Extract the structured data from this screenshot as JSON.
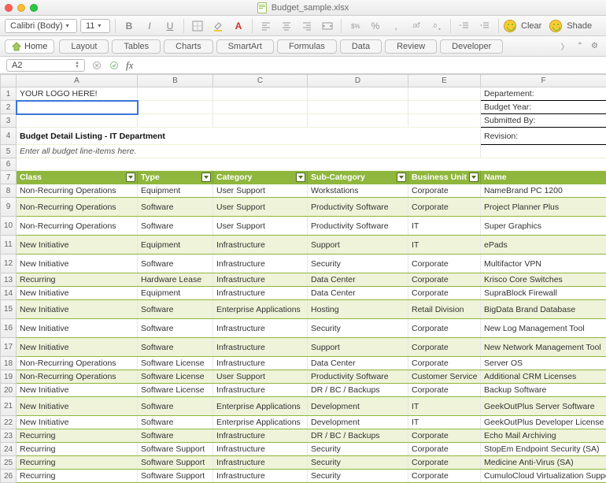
{
  "window": {
    "filename": "Budget_sample.xlsx"
  },
  "toolbar": {
    "font": "Calibri (Body)",
    "size": "11",
    "clear": "Clear",
    "shade": "Shade"
  },
  "ribbon": {
    "home": "Home",
    "tabs": [
      "Layout",
      "Tables",
      "Charts",
      "SmartArt",
      "Formulas",
      "Data",
      "Review",
      "Developer"
    ]
  },
  "fxbar": {
    "cellref": "A2",
    "fx": "fx"
  },
  "columns": [
    "A",
    "B",
    "C",
    "D",
    "E",
    "F"
  ],
  "top": {
    "logo": "YOUR LOGO HERE!",
    "dept": "Departement:",
    "year": "Budget Year:",
    "submitted": "Submitted By:",
    "revision": "Revision:",
    "title": "Budget Detail Listing - IT Department",
    "subtitle": "Enter all budget line-items here."
  },
  "headers": [
    "Class",
    "Type",
    "Category",
    "Sub-Category",
    "Business Unit",
    "Name"
  ],
  "rows": [
    {
      "n": 8,
      "tall": false,
      "c": [
        "Non-Recurring Operations",
        "Equipment",
        "User Support",
        "Workstations",
        "Corporate",
        "NameBrand PC 1200"
      ]
    },
    {
      "n": 9,
      "tall": true,
      "c": [
        "Non-Recurring Operations",
        "Software",
        "User Support",
        "Productivity Software",
        "Corporate",
        "Project Planner Plus"
      ]
    },
    {
      "n": 10,
      "tall": true,
      "c": [
        "Non-Recurring Operations",
        "Software",
        "User Support",
        "Productivity Software",
        "IT",
        "Super Graphics"
      ]
    },
    {
      "n": 11,
      "tall": true,
      "c": [
        "New Initiative",
        "Equipment",
        "Infrastructure",
        "Support",
        "IT",
        "ePads"
      ]
    },
    {
      "n": 12,
      "tall": true,
      "c": [
        "New Initiative",
        "Software",
        "Infrastructure",
        "Security",
        "Corporate",
        "Multifactor VPN"
      ]
    },
    {
      "n": 13,
      "tall": false,
      "c": [
        "Recurring",
        "Hardware Lease",
        "Infrastructure",
        "Data Center",
        "Corporate",
        "Krisco Core Switches"
      ]
    },
    {
      "n": 14,
      "tall": false,
      "c": [
        "New Initiative",
        "Equipment",
        "Infrastructure",
        "Data Center",
        "Corporate",
        "SupraBlock Firewall"
      ]
    },
    {
      "n": 15,
      "tall": true,
      "c": [
        "New Initiative",
        "Software",
        "Enterprise Applications",
        "Hosting",
        "Retail Division",
        "BigData Brand Database"
      ]
    },
    {
      "n": 16,
      "tall": true,
      "c": [
        "New Initiative",
        "Software",
        "Infrastructure",
        "Security",
        "Corporate",
        "New Log Management Tool"
      ]
    },
    {
      "n": 17,
      "tall": true,
      "c": [
        "New Initiative",
        "Software",
        "Infrastructure",
        "Support",
        "Corporate",
        "New Network Management Tool"
      ]
    },
    {
      "n": 18,
      "tall": false,
      "c": [
        "Non-Recurring Operations",
        "Software License",
        "Infrastructure",
        "Data Center",
        "Corporate",
        "Server OS"
      ]
    },
    {
      "n": 19,
      "tall": false,
      "c": [
        "Non-Recurring Operations",
        "Software License",
        "User Support",
        "Productivity Software",
        "Customer Service",
        "Additional CRM Licenses"
      ]
    },
    {
      "n": 20,
      "tall": false,
      "c": [
        "New Initiative",
        "Software License",
        "Infrastructure",
        "DR / BC / Backups",
        "Corporate",
        "Backup Software"
      ]
    },
    {
      "n": 21,
      "tall": true,
      "c": [
        "New Initiative",
        "Software",
        "Enterprise Applications",
        "Development",
        "IT",
        "GeekOutPlus Server Software"
      ]
    },
    {
      "n": 22,
      "tall": false,
      "c": [
        "New Initiative",
        "Software",
        "Enterprise Applications",
        "Development",
        "IT",
        "GeekOutPlus Developer License"
      ]
    },
    {
      "n": 23,
      "tall": false,
      "c": [
        "Recurring",
        "Software",
        "Infrastructure",
        "DR / BC / Backups",
        "Corporate",
        "Echo Mail Archiving"
      ]
    },
    {
      "n": 24,
      "tall": false,
      "c": [
        "Recurring",
        "Software Support",
        "Infrastructure",
        "Security",
        "Corporate",
        "StopEm Endpoint Security (SA)"
      ]
    },
    {
      "n": 25,
      "tall": false,
      "c": [
        "Recurring",
        "Software Support",
        "Infrastructure",
        "Security",
        "Corporate",
        "Medicine Anti-Virus (SA)"
      ]
    },
    {
      "n": 26,
      "tall": false,
      "c": [
        "Recurring",
        "Software Support",
        "Infrastructure",
        "Security",
        "Corporate",
        "CumuloCloud Virtualization Support"
      ]
    }
  ]
}
